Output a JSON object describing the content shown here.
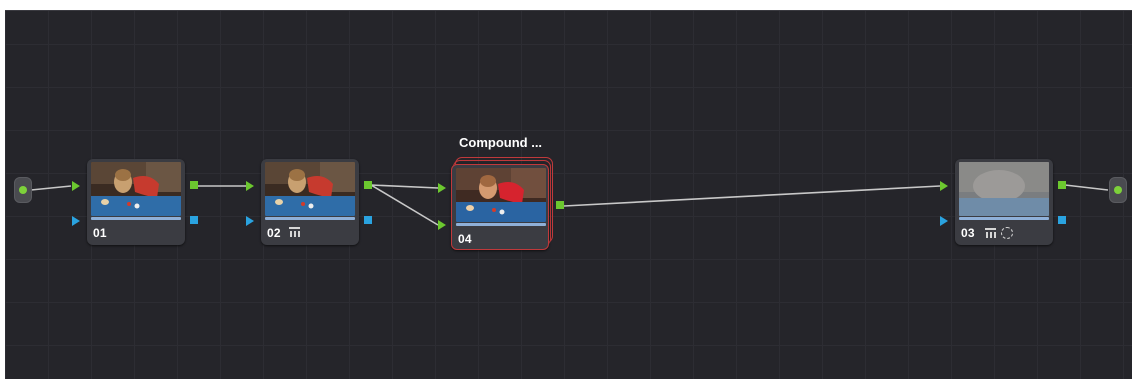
{
  "node_editor": {
    "compound_title": "Compound ...",
    "nodes": [
      {
        "label": "01",
        "has_curves_icon": false,
        "has_window_icon": false,
        "thumbnail": "clear"
      },
      {
        "label": "02",
        "has_curves_icon": true,
        "has_window_icon": false,
        "thumbnail": "clear"
      },
      {
        "label": "04",
        "has_curves_icon": false,
        "has_window_icon": false,
        "thumbnail": "warm",
        "compound": true
      },
      {
        "label": "03",
        "has_curves_icon": true,
        "has_window_icon": true,
        "thumbnail": "blurred"
      }
    ],
    "colors": {
      "background": "#25252a",
      "rgb_port": "#6cc82f",
      "alpha_port": "#2aa3e0",
      "compound_border": "#c0393b",
      "wire": "#c8c8c8"
    }
  }
}
